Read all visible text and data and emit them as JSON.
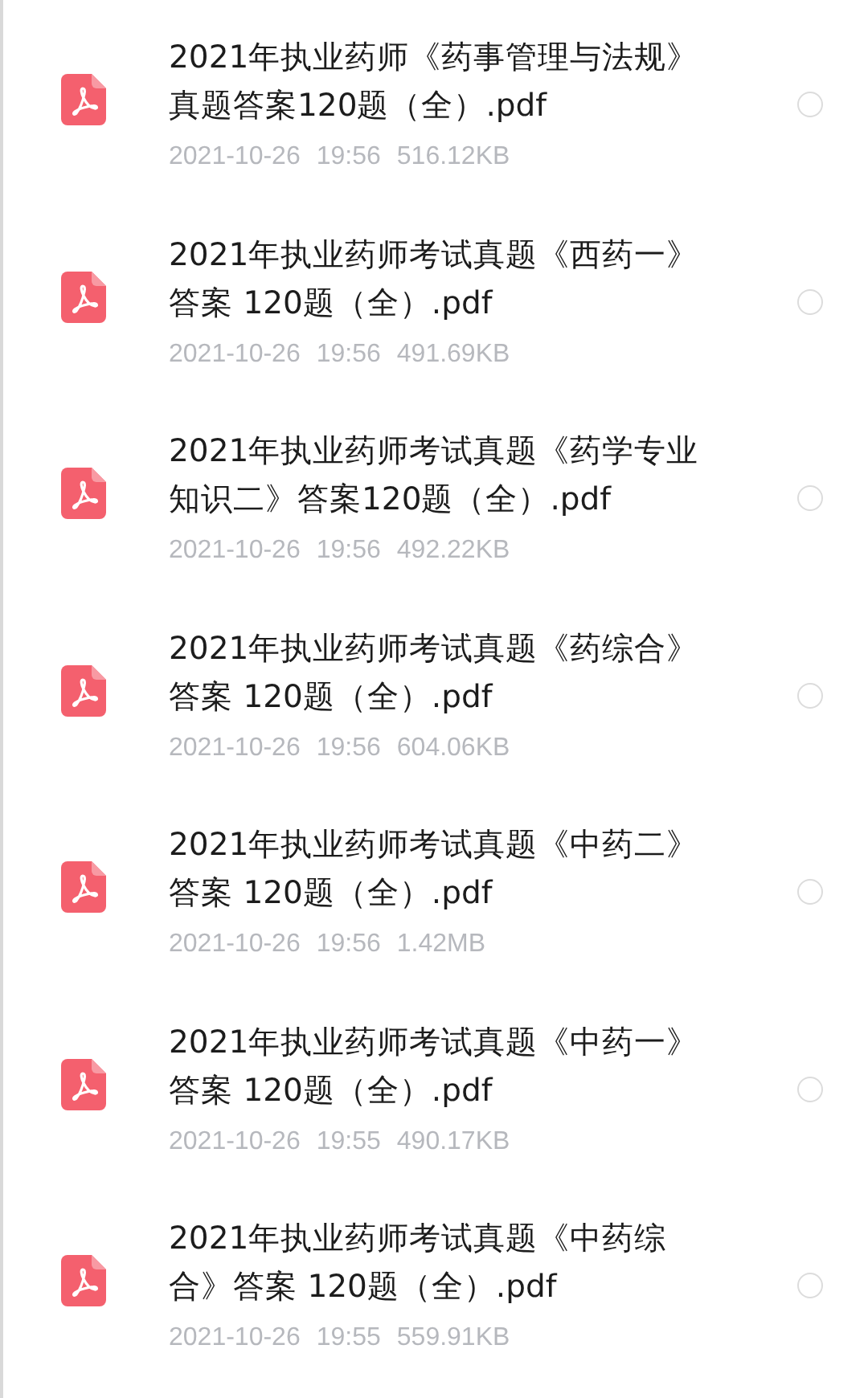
{
  "files": [
    {
      "name_lines": [
        "2021年执业药师《药事管理与法规》",
        "真题答案120题（全）.pdf"
      ],
      "date": "2021-10-26",
      "time": "19:56",
      "size": "516.12KB",
      "selected": false
    },
    {
      "name_lines": [
        "2021年执业药师考试真题《西药一》",
        "答案 120题（全）.pdf"
      ],
      "date": "2021-10-26",
      "time": "19:56",
      "size": "491.69KB",
      "selected": false
    },
    {
      "name_lines": [
        "2021年执业药师考试真题《药学专业",
        "知识二》答案120题（全）.pdf"
      ],
      "date": "2021-10-26",
      "time": "19:56",
      "size": "492.22KB",
      "selected": false
    },
    {
      "name_lines": [
        "2021年执业药师考试真题《药综合》",
        "答案 120题（全）.pdf"
      ],
      "date": "2021-10-26",
      "time": "19:56",
      "size": "604.06KB",
      "selected": false
    },
    {
      "name_lines": [
        "2021年执业药师考试真题《中药二》",
        "答案 120题（全）.pdf"
      ],
      "date": "2021-10-26",
      "time": "19:56",
      "size": "1.42MB",
      "selected": false
    },
    {
      "name_lines": [
        "2021年执业药师考试真题《中药一》",
        "答案 120题（全）.pdf"
      ],
      "date": "2021-10-26",
      "time": "19:55",
      "size": "490.17KB",
      "selected": false
    },
    {
      "name_lines": [
        "2021年执业药师考试真题《中药综",
        "合》答案 120题（全）.pdf"
      ],
      "date": "2021-10-26",
      "time": "19:55",
      "size": "559.91KB",
      "selected": false
    }
  ]
}
